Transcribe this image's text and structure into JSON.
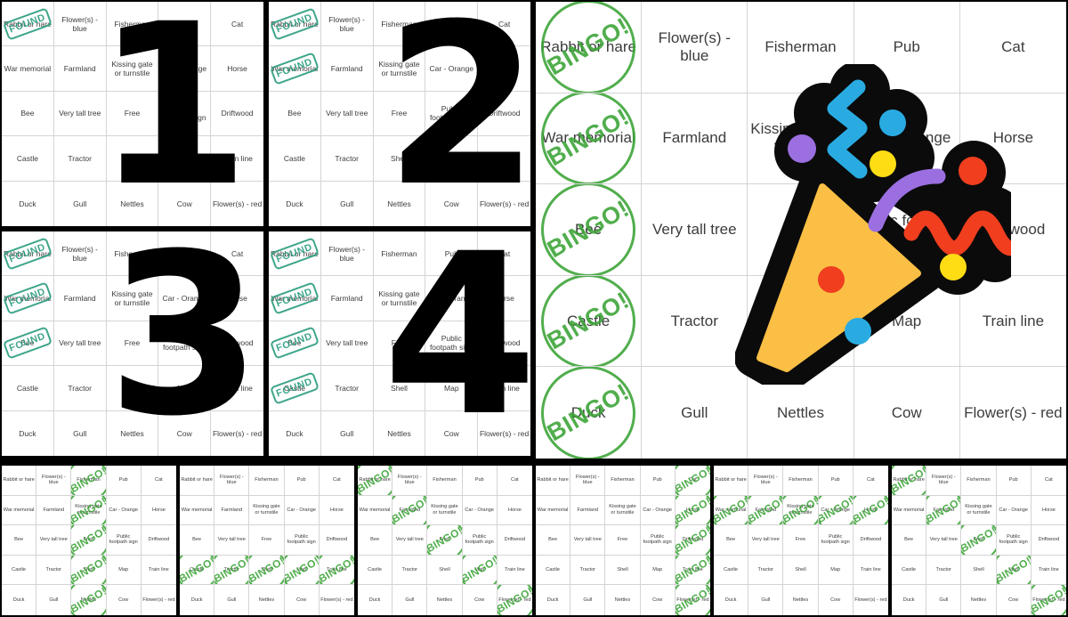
{
  "theme": {
    "page_background": "#000000",
    "card_background": "#ffffff",
    "grid_line": "#d4d4d4",
    "cell_text": "#3c3c3c",
    "found_stamp_color": "#2e9e82",
    "bingo_stamp_color": "#3aa335",
    "number_color": "#000000"
  },
  "stamp_labels": {
    "found": "FOUND",
    "bingo": "BINGO!"
  },
  "emoji": {
    "name": "party-popper",
    "colors": {
      "cone": "#FBBF45",
      "outline": "#0B0B0B",
      "blue": "#29ABE2",
      "red": "#F03E1E",
      "yellow": "#FFDD15",
      "purple": "#9B6FE0",
      "cyan_dot": "#29ABE2"
    }
  },
  "board": {
    "rows": 5,
    "cols": 5,
    "cells": [
      [
        "Rabbit or hare",
        "Flower(s) - blue",
        "Fisherman",
        "Pub",
        "Cat"
      ],
      [
        "War memorial",
        "Farmland",
        "Kissing gate or turnstile",
        "Car - Orange",
        "Horse"
      ],
      [
        "Bee",
        "Very tall tree",
        "Free",
        "Public footpath sign",
        "Driftwood"
      ],
      [
        "Castle",
        "Tractor",
        "Shell",
        "Map",
        "Train line"
      ],
      [
        "Duck",
        "Gull",
        "Nettles",
        "Cow",
        "Flower(s) - red"
      ]
    ]
  },
  "top_cards": [
    {
      "id": "card-1",
      "number": "1",
      "stamp_type": "found",
      "stamped": [
        [
          0,
          0
        ]
      ]
    },
    {
      "id": "card-2",
      "number": "2",
      "stamp_type": "found",
      "stamped": [
        [
          0,
          0
        ],
        [
          1,
          0
        ]
      ]
    },
    {
      "id": "card-3",
      "number": "3",
      "stamp_type": "found",
      "stamped": [
        [
          0,
          0
        ],
        [
          1,
          0
        ],
        [
          2,
          0
        ]
      ]
    },
    {
      "id": "card-4",
      "number": "4",
      "stamp_type": "found",
      "stamped": [
        [
          0,
          0
        ],
        [
          1,
          0
        ],
        [
          2,
          0
        ],
        [
          3,
          0
        ]
      ]
    }
  ],
  "big_card": {
    "id": "card-big",
    "stamp_type": "bingo",
    "stamped": [
      [
        0,
        0
      ],
      [
        1,
        0
      ],
      [
        2,
        0
      ],
      [
        3,
        0
      ],
      [
        4,
        0
      ]
    ],
    "has_celebration_emoji": true
  },
  "mini_cards": [
    {
      "id": "mini-1",
      "pattern": "column-3",
      "stamp_type": "bingo",
      "stamped": [
        [
          0,
          2
        ],
        [
          1,
          2
        ],
        [
          2,
          2
        ],
        [
          3,
          2
        ],
        [
          4,
          2
        ]
      ]
    },
    {
      "id": "mini-2",
      "pattern": "row-4",
      "stamp_type": "bingo",
      "stamped": [
        [
          3,
          0
        ],
        [
          3,
          1
        ],
        [
          3,
          2
        ],
        [
          3,
          3
        ],
        [
          3,
          4
        ]
      ]
    },
    {
      "id": "mini-3",
      "pattern": "diagonal-down",
      "stamp_type": "bingo",
      "stamped": [
        [
          0,
          0
        ],
        [
          1,
          1
        ],
        [
          2,
          2
        ],
        [
          3,
          3
        ],
        [
          4,
          4
        ]
      ]
    },
    {
      "id": "mini-4",
      "pattern": "column-5",
      "stamp_type": "bingo",
      "stamped": [
        [
          0,
          4
        ],
        [
          1,
          4
        ],
        [
          2,
          4
        ],
        [
          3,
          4
        ],
        [
          4,
          4
        ]
      ]
    },
    {
      "id": "mini-5",
      "pattern": "row-2",
      "stamp_type": "bingo",
      "stamped": [
        [
          1,
          0
        ],
        [
          1,
          1
        ],
        [
          1,
          2
        ],
        [
          1,
          3
        ],
        [
          1,
          4
        ]
      ]
    },
    {
      "id": "mini-6",
      "pattern": "diagonal-down",
      "stamp_type": "bingo",
      "stamped": [
        [
          0,
          0
        ],
        [
          1,
          1
        ],
        [
          2,
          2
        ],
        [
          3,
          3
        ],
        [
          4,
          4
        ]
      ]
    }
  ]
}
